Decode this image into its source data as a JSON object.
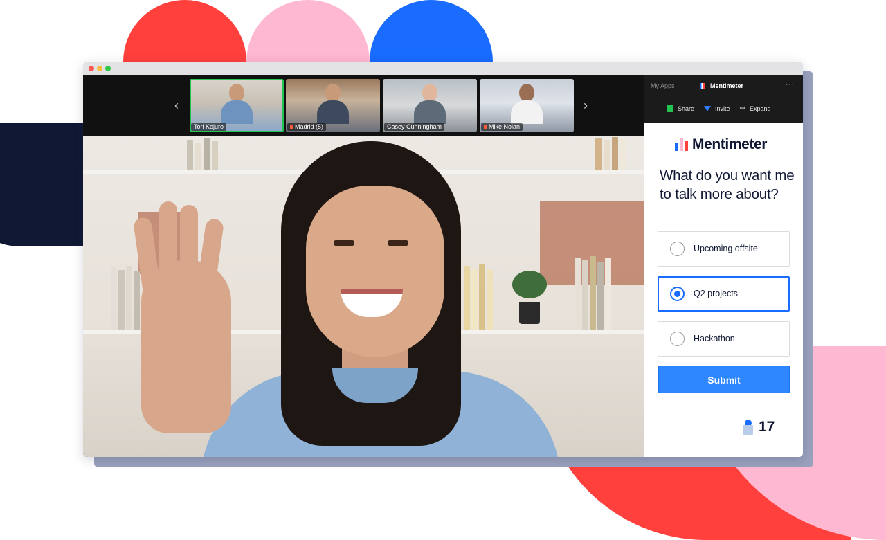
{
  "meeting": {
    "participants": [
      {
        "name": "Tori Kojuro",
        "active": true,
        "muted": false
      },
      {
        "name": "Madrid (5)",
        "active": false,
        "muted": true
      },
      {
        "name": "Casey Cunningham",
        "active": false,
        "muted": false
      },
      {
        "name": "Mike Nolan",
        "active": false,
        "muted": true
      }
    ],
    "nav_prev_icon": "chevron-left-icon",
    "nav_next_icon": "chevron-right-icon"
  },
  "apps_panel": {
    "my_apps_label": "My Apps",
    "app_name": "Mentimeter",
    "more_icon": "more-dots-icon",
    "actions": {
      "share_label": "Share",
      "invite_label": "Invite",
      "expand_label": "Expand"
    }
  },
  "poll": {
    "brand": "Mentimeter",
    "question": "What do you want me to talk more about?",
    "options": [
      {
        "label": "Upcoming offsite",
        "selected": false
      },
      {
        "label": "Q2 projects",
        "selected": true
      },
      {
        "label": "Hackathon",
        "selected": false
      }
    ],
    "submit_label": "Submit",
    "participant_count": "17"
  },
  "colors": {
    "brand_blue": "#196cff",
    "brand_red": "#ff403d",
    "brand_pink": "#ffb8d1",
    "brand_navy": "#101834",
    "active_speaker": "#23c552"
  }
}
